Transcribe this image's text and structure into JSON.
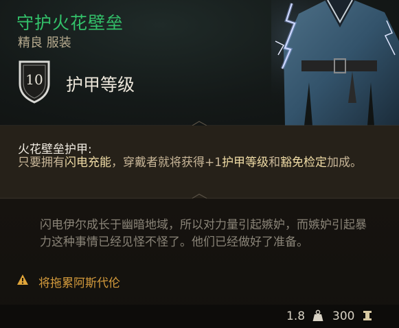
{
  "item": {
    "name": "守护火花壁垒",
    "subtitle": "精良 服装",
    "armor_class_value": "10",
    "armor_class_label": "护甲等级"
  },
  "feature": {
    "title": "火花壁垒护甲:",
    "desc_1": "只要拥有",
    "kw_1": "闪电充能",
    "desc_2": "，穿戴者就将获得+1",
    "kw_2": "护甲等级",
    "desc_3": "和",
    "kw_3": "豁免检定",
    "desc_4": "加成。"
  },
  "flavor_text": "闪电伊尔成长于幽暗地域，所以对力量引起嫉妒，而嫉妒引起暴力这种事情已经见怪不怪了。他们已经做好了准备。",
  "warning": {
    "icon": "warning-icon",
    "text": "将拖累阿斯代伦"
  },
  "footer": {
    "weight": "1.8",
    "weight_icon": "weight-icon",
    "price": "300",
    "price_icon": "gold-coin-icon"
  },
  "colors": {
    "item_name": "#33c16a",
    "keyword": "#f0dca6",
    "description": "#c8b698",
    "warning": "#d49b3c"
  }
}
